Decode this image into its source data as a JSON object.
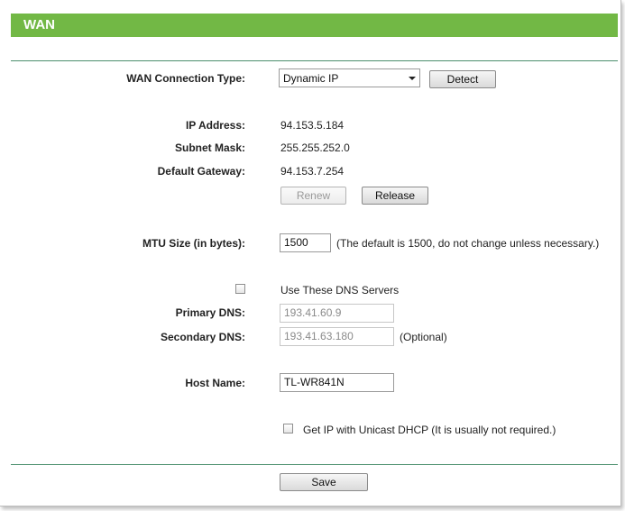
{
  "header": {
    "title": "WAN"
  },
  "form": {
    "connection_type": {
      "label": "WAN Connection Type:",
      "selected": "Dynamic IP",
      "detect_label": "Detect"
    },
    "ip_address": {
      "label": "IP Address:",
      "value": "94.153.5.184"
    },
    "subnet_mask": {
      "label": "Subnet Mask:",
      "value": "255.255.252.0"
    },
    "default_gateway": {
      "label": "Default Gateway:",
      "value": "94.153.7.254"
    },
    "renew_label": "Renew",
    "release_label": "Release",
    "mtu": {
      "label": "MTU Size (in bytes):",
      "value": "1500",
      "hint": "(The default is 1500, do not change unless necessary.)"
    },
    "dns": {
      "use_label": "Use These DNS Servers",
      "checked": false,
      "primary_label": "Primary DNS:",
      "primary_value": "193.41.60.9",
      "secondary_label": "Secondary DNS:",
      "secondary_value": "193.41.63.180",
      "secondary_hint": "(Optional)"
    },
    "host_name": {
      "label": "Host Name:",
      "value": "TL-WR841N"
    },
    "unicast": {
      "label": "Get IP with Unicast DHCP (It is usually not required.)",
      "checked": false
    },
    "save_label": "Save"
  },
  "colors": {
    "header_green": "#72b845",
    "divider": "#4b8f6d"
  }
}
